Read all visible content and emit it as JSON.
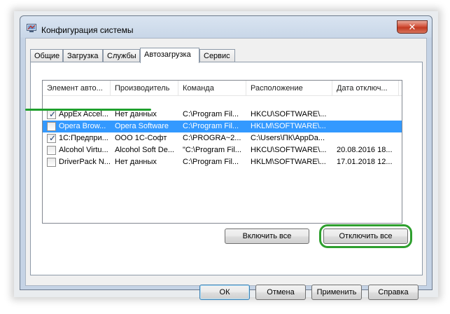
{
  "window": {
    "title": "Конфигурация системы",
    "close_glyph": "✕",
    "accent_color": "#3399ff",
    "highlight_color": "#2e9f2e"
  },
  "tabs": [
    {
      "label": "Общие"
    },
    {
      "label": "Загрузка"
    },
    {
      "label": "Службы"
    },
    {
      "label": "Автозагрузка",
      "active": true
    },
    {
      "label": "Сервис"
    }
  ],
  "startup_list": {
    "columns": [
      "Элемент авто...",
      "Производитель",
      "Команда",
      "Расположение",
      "Дата отключ..."
    ],
    "rows": [
      {
        "checked": true,
        "item": "AppEx Accel...",
        "vendor": "Нет данных",
        "command": "C:\\Program Fil...",
        "location": "HKCU\\SOFTWARE\\...",
        "date": ""
      },
      {
        "checked": false,
        "item": "Opera Brow...",
        "vendor": "Opera Software",
        "command": "C:\\Program Fil...",
        "location": "HKLM\\SOFTWARE\\...",
        "date": "",
        "selected": true
      },
      {
        "checked": true,
        "item": "1С:Предпри...",
        "vendor": "ООО 1С-Софт",
        "command": "C:\\PROGRA~2...",
        "location": "C:\\Users\\ПК\\AppDa...",
        "date": ""
      },
      {
        "checked": false,
        "item": "Alcohol Virtu...",
        "vendor": "Alcohol Soft De...",
        "command": "\"C:\\Program Fil...",
        "location": "HKCU\\SOFTWARE\\...",
        "date": "20.08.2016 18..."
      },
      {
        "checked": false,
        "item": "DriverPack N...",
        "vendor": "Нет данных",
        "command": "C:\\Program Fil...",
        "location": "HKLM\\SOFTWARE\\...",
        "date": "17.01.2018 12..."
      }
    ]
  },
  "panel_buttons": {
    "enable_all": "Включить все",
    "disable_all": "Отключить все"
  },
  "dialog_buttons": {
    "ok": "ОК",
    "cancel": "Отмена",
    "apply": "Применить",
    "help": "Справка"
  }
}
